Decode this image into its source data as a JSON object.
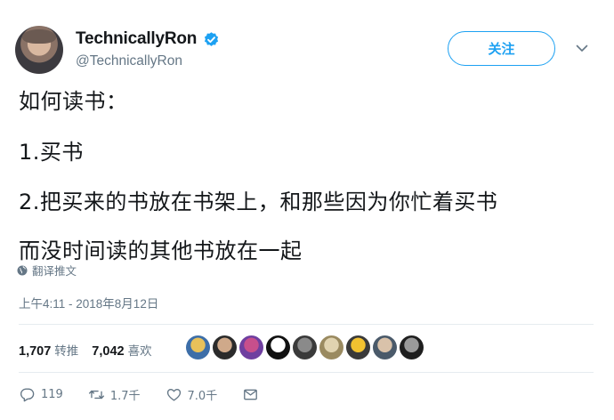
{
  "author": {
    "display_name": "TechnicallyRon",
    "handle": "@TechnicallyRon",
    "verified": true
  },
  "follow_button": {
    "label": "关注"
  },
  "tweet": {
    "lines": [
      "如何读书：",
      "1.买书",
      "2.把买来的书放在书架上，和那些因为你忙着买书",
      "而没时间读的其他书放在一起"
    ]
  },
  "translate_link": {
    "label": "翻译推文",
    "icon": "globe-icon"
  },
  "timestamp": "上午4:11 - 2018年8月12日",
  "stats": {
    "retweets": {
      "count": "1,707",
      "label": "转推"
    },
    "likes": {
      "count": "7,042",
      "label": "喜欢"
    }
  },
  "liker_avatars": [
    {
      "name": "liker-avatar-1",
      "colors": [
        "#e8c15a",
        "#3d6ea8"
      ]
    },
    {
      "name": "liker-avatar-2",
      "colors": [
        "#cfa98a",
        "#2b2b2b"
      ]
    },
    {
      "name": "liker-avatar-3",
      "colors": [
        "#c74f8c",
        "#6f3fa0"
      ]
    },
    {
      "name": "liker-avatar-4",
      "colors": [
        "#ffffff",
        "#111111"
      ]
    },
    {
      "name": "liker-avatar-5",
      "colors": [
        "#8a8a8a",
        "#3a3a3a"
      ]
    },
    {
      "name": "liker-avatar-6",
      "colors": [
        "#e0d3b0",
        "#9a8a60"
      ]
    },
    {
      "name": "liker-avatar-7",
      "colors": [
        "#f2c230",
        "#3a3a3a"
      ]
    },
    {
      "name": "liker-avatar-8",
      "colors": [
        "#d9c2aa",
        "#4a5a6a"
      ]
    },
    {
      "name": "liker-avatar-9",
      "colors": [
        "#9a9a9a",
        "#1f1f1f"
      ]
    }
  ],
  "actions": {
    "reply": {
      "count": "119",
      "icon": "reply-icon"
    },
    "retweet": {
      "count": "1.7千",
      "icon": "retweet-icon"
    },
    "like": {
      "count": "7.0千",
      "icon": "heart-icon"
    },
    "message": {
      "icon": "envelope-icon"
    }
  },
  "colors": {
    "accent": "#1da1f2",
    "text": "#14171a",
    "secondary": "#657786"
  }
}
